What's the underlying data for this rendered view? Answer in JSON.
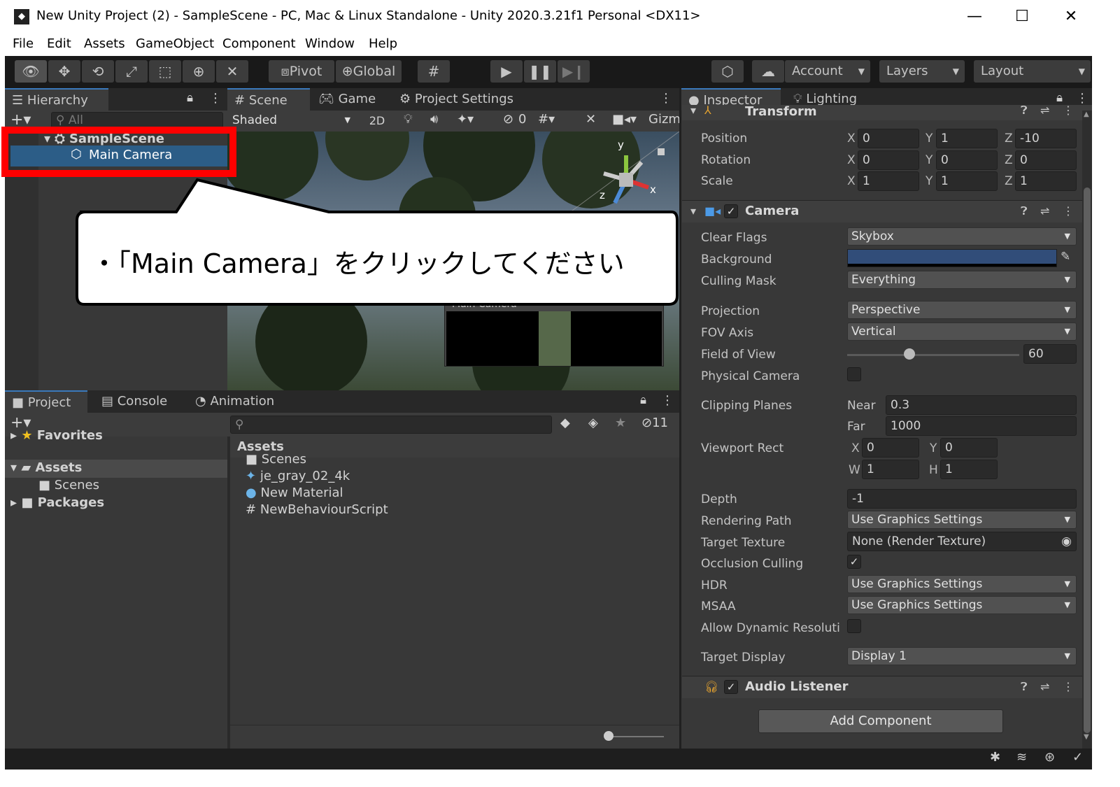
{
  "window": {
    "title": "New Unity Project (2) - SampleScene - PC, Mac & Linux Standalone - Unity 2020.3.21f1 Personal <DX11>",
    "minimize": "—",
    "maximize": "☐",
    "close": "✕"
  },
  "menu": [
    "File",
    "Edit",
    "Assets",
    "GameObject",
    "Component",
    "Window",
    "Help"
  ],
  "toolbar": {
    "pivot": "Pivot",
    "global": "Global",
    "account": "Account",
    "layers": "Layers",
    "layout": "Layout"
  },
  "hierarchy": {
    "tab": "Hierarchy",
    "search_placeholder": "All",
    "scene": "SampleScene",
    "selected": "Main Camera"
  },
  "scene": {
    "tabs": [
      "Scene",
      "Game",
      "Project Settings"
    ],
    "shading": "Shaded",
    "mode2d": "2D",
    "hidden_count": "0",
    "gizmos": "Gizm",
    "axis_y": "y",
    "axis_x": "x",
    "axis_z": "z",
    "preview_title": "Main Camera"
  },
  "callout": {
    "text": "・「Main Camera」をクリックしてください"
  },
  "project": {
    "tabs": [
      "Project",
      "Console",
      "Animation"
    ],
    "hidden_count": "11",
    "tree": {
      "favorites": "Favorites",
      "assets": "Assets",
      "scenes": "Scenes",
      "packages": "Packages"
    },
    "breadcrumb": "Assets",
    "items": [
      "Scenes",
      "je_gray_02_4k",
      "New Material",
      "NewBehaviourScript"
    ]
  },
  "inspector": {
    "tabs": [
      "Inspector",
      "Lighting"
    ],
    "transform": {
      "title": "Transform",
      "position": {
        "label": "Position",
        "x": "0",
        "y": "1",
        "z": "-10"
      },
      "rotation": {
        "label": "Rotation",
        "x": "0",
        "y": "0",
        "z": "0"
      },
      "scale": {
        "label": "Scale",
        "x": "1",
        "y": "1",
        "z": "1"
      }
    },
    "axis": {
      "x": "X",
      "y": "Y",
      "z": "Z",
      "w": "W",
      "h": "H"
    },
    "camera": {
      "title": "Camera",
      "clear_flags": {
        "label": "Clear Flags",
        "value": "Skybox"
      },
      "background": {
        "label": "Background",
        "color": "#314d79"
      },
      "culling_mask": {
        "label": "Culling Mask",
        "value": "Everything"
      },
      "projection": {
        "label": "Projection",
        "value": "Perspective"
      },
      "fov_axis": {
        "label": "FOV Axis",
        "value": "Vertical"
      },
      "fov": {
        "label": "Field of View",
        "value": "60",
        "slider_fraction": 0.36
      },
      "physical": {
        "label": "Physical Camera"
      },
      "clipping": {
        "label": "Clipping Planes",
        "near_label": "Near",
        "near": "0.3",
        "far_label": "Far",
        "far": "1000"
      },
      "viewport": {
        "label": "Viewport Rect",
        "x": "0",
        "y": "0",
        "w": "1",
        "h": "1"
      },
      "depth": {
        "label": "Depth",
        "value": "-1"
      },
      "rendering_path": {
        "label": "Rendering Path",
        "value": "Use Graphics Settings"
      },
      "target_texture": {
        "label": "Target Texture",
        "value": "None (Render Texture)"
      },
      "occlusion": {
        "label": "Occlusion Culling",
        "check": "✓"
      },
      "hdr": {
        "label": "HDR",
        "value": "Use Graphics Settings"
      },
      "msaa": {
        "label": "MSAA",
        "value": "Use Graphics Settings"
      },
      "dynamic_res": {
        "label": "Allow Dynamic Resoluti"
      },
      "target_display": {
        "label": "Target Display",
        "value": "Display 1"
      }
    },
    "audio": {
      "title": "Audio Listener",
      "check": "✓"
    },
    "add_component": "Add Component"
  },
  "colors": {
    "highlight": "#ff0000",
    "selection": "#2c5d87"
  }
}
